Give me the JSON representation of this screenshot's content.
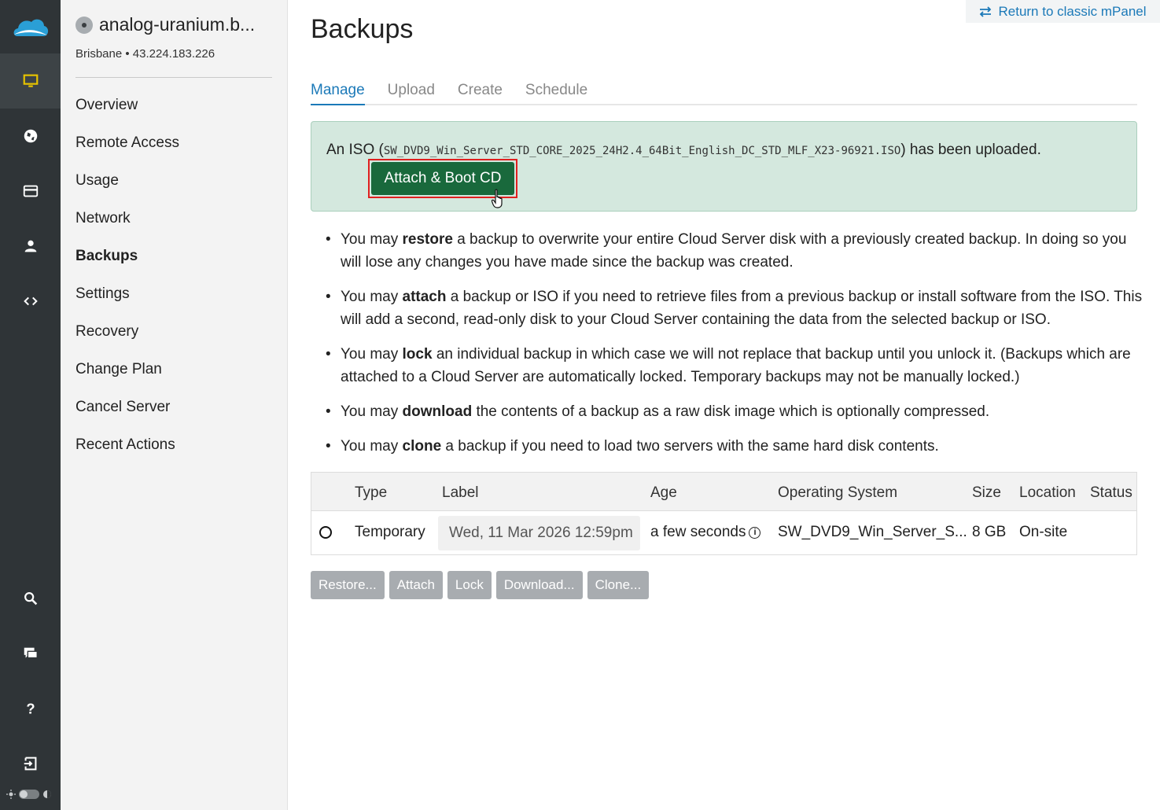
{
  "rail": {
    "icons": [
      "cloud-logo-icon",
      "monitor-icon",
      "globe-icon",
      "credit-card-icon",
      "user-icon",
      "code-icon",
      "search-icon",
      "chat-icon",
      "help-icon",
      "logout-icon"
    ],
    "active_color": "#e6c200"
  },
  "sidebar": {
    "server_name": "analog-uranium.b...",
    "location": "Brisbane • 43.224.183.226",
    "items": [
      {
        "label": "Overview"
      },
      {
        "label": "Remote Access"
      },
      {
        "label": "Usage"
      },
      {
        "label": "Network"
      },
      {
        "label": "Backups",
        "active": true
      },
      {
        "label": "Settings"
      },
      {
        "label": "Recovery"
      },
      {
        "label": "Change Plan"
      },
      {
        "label": "Cancel Server"
      },
      {
        "label": "Recent Actions"
      }
    ]
  },
  "header": {
    "classic_link": "Return to classic mPanel",
    "title": "Backups"
  },
  "tabs": [
    {
      "label": "Manage",
      "active": true
    },
    {
      "label": "Upload"
    },
    {
      "label": "Create"
    },
    {
      "label": "Schedule"
    }
  ],
  "alert": {
    "prefix": "An ISO (",
    "iso_name": "SW_DVD9_Win_Server_STD_CORE_2025_24H2.4_64Bit_English_DC_STD_MLF_X23-96921.ISO",
    "suffix": ") has been uploaded.",
    "button": "Attach & Boot CD",
    "bg_color": "#d4e8de",
    "button_color": "#19693c"
  },
  "bullets": [
    {
      "pre": "You may ",
      "bold": "restore",
      "post": " a backup to overwrite your entire Cloud Server disk with a previously created backup. In doing so you will lose any changes you have made since the backup was created."
    },
    {
      "pre": "You may ",
      "bold": "attach",
      "post": " a backup or ISO if you need to retrieve files from a previous backup or install software from the ISO. This will add a second, read-only disk to your Cloud Server containing the data from the selected backup or ISO."
    },
    {
      "pre": "You may ",
      "bold": "lock",
      "post": " an individual backup in which case we will not replace that backup until you unlock it. (Backups which are attached to a Cloud Server are automatically locked. Temporary backups may not be manually locked.)"
    },
    {
      "pre": "You may ",
      "bold": "download",
      "post": " the contents of a backup as a raw disk image which is optionally compressed."
    },
    {
      "pre": "You may ",
      "bold": "clone",
      "post": " a backup if you need to load two servers with the same hard disk contents."
    }
  ],
  "table": {
    "columns": [
      "Type",
      "Label",
      "Age",
      "Operating System",
      "Size",
      "Location",
      "Status"
    ],
    "rows": [
      {
        "type": "Temporary",
        "label": "Wed, 11 Mar 2026 12:59pm",
        "age": "a few seconds",
        "os": "SW_DVD9_Win_Server_S...",
        "size": "8 GB",
        "location": "On-site",
        "status": ""
      }
    ]
  },
  "actions": [
    "Restore...",
    "Attach",
    "Lock",
    "Download...",
    "Clone..."
  ]
}
